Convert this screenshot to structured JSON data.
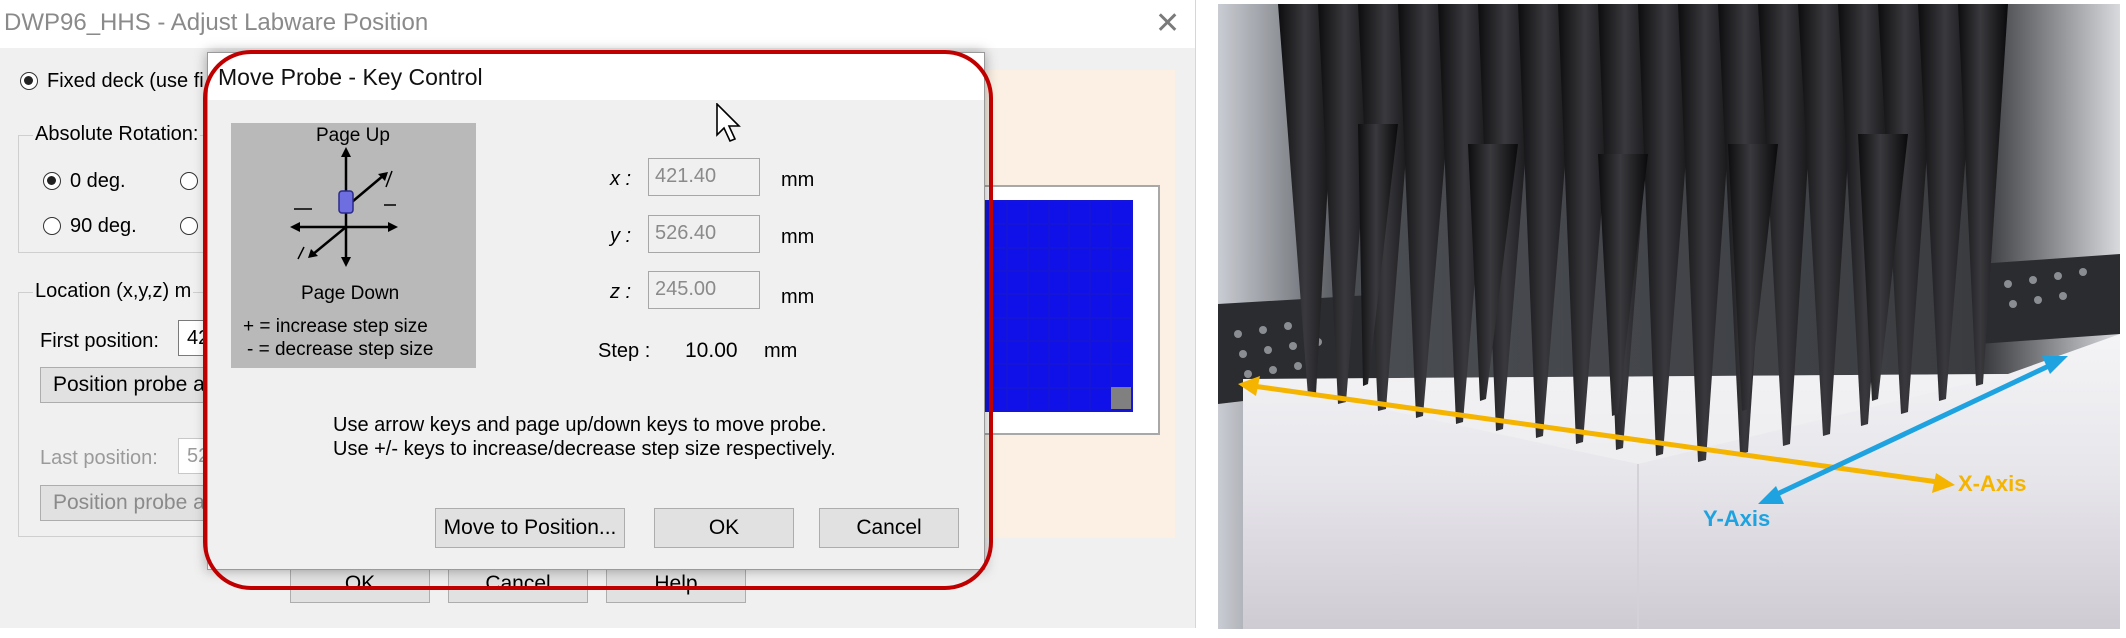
{
  "parent_window": {
    "title": "DWP96_HHS - Adjust Labware Position",
    "close_glyph": "✕",
    "fixed_deck_label": "Fixed deck (use fi",
    "rotation_group_label": "Absolute Rotation:",
    "rot_0": "0 deg.",
    "rot_90": "90 deg.",
    "location_group_label": "Location (x,y,z) m",
    "first_position_label": "First position:",
    "first_position_value": "42",
    "position_probe_first": "Position probe at",
    "last_position_label": "Last position:",
    "last_position_value": "52",
    "position_probe_last": "Position probe a",
    "ok": "OK",
    "cancel": "Cancel",
    "help": "Help"
  },
  "dialog": {
    "title": "Move Probe - Key Control",
    "keypad": {
      "page_up": "Page Up",
      "page_down": "Page Down",
      "increase": "+ = increase step size",
      "decrease": "- = decrease step size"
    },
    "coords": {
      "x_label": "x :",
      "x_value": "421.40",
      "y_label": "y :",
      "y_value": "526.40",
      "z_label": "z :",
      "z_value": "245.00",
      "unit": "mm"
    },
    "step_label": "Step :",
    "step_value": "10.00",
    "step_unit": "mm",
    "hint_line1": "Use arrow keys and page up/down keys to move probe.",
    "hint_line2": "Use +/- keys to increase/decrease step size respectively.",
    "move_button": "Move to Position...",
    "ok_button": "OK",
    "cancel_button": "Cancel"
  },
  "photo": {
    "x_axis_label": "X-Axis",
    "y_axis_label": "Y-Axis",
    "x_axis_color": "#f5b400",
    "y_axis_color": "#1fa3e0"
  },
  "colors": {
    "highlight": "#c00000",
    "plate_blue": "#1010e8"
  }
}
